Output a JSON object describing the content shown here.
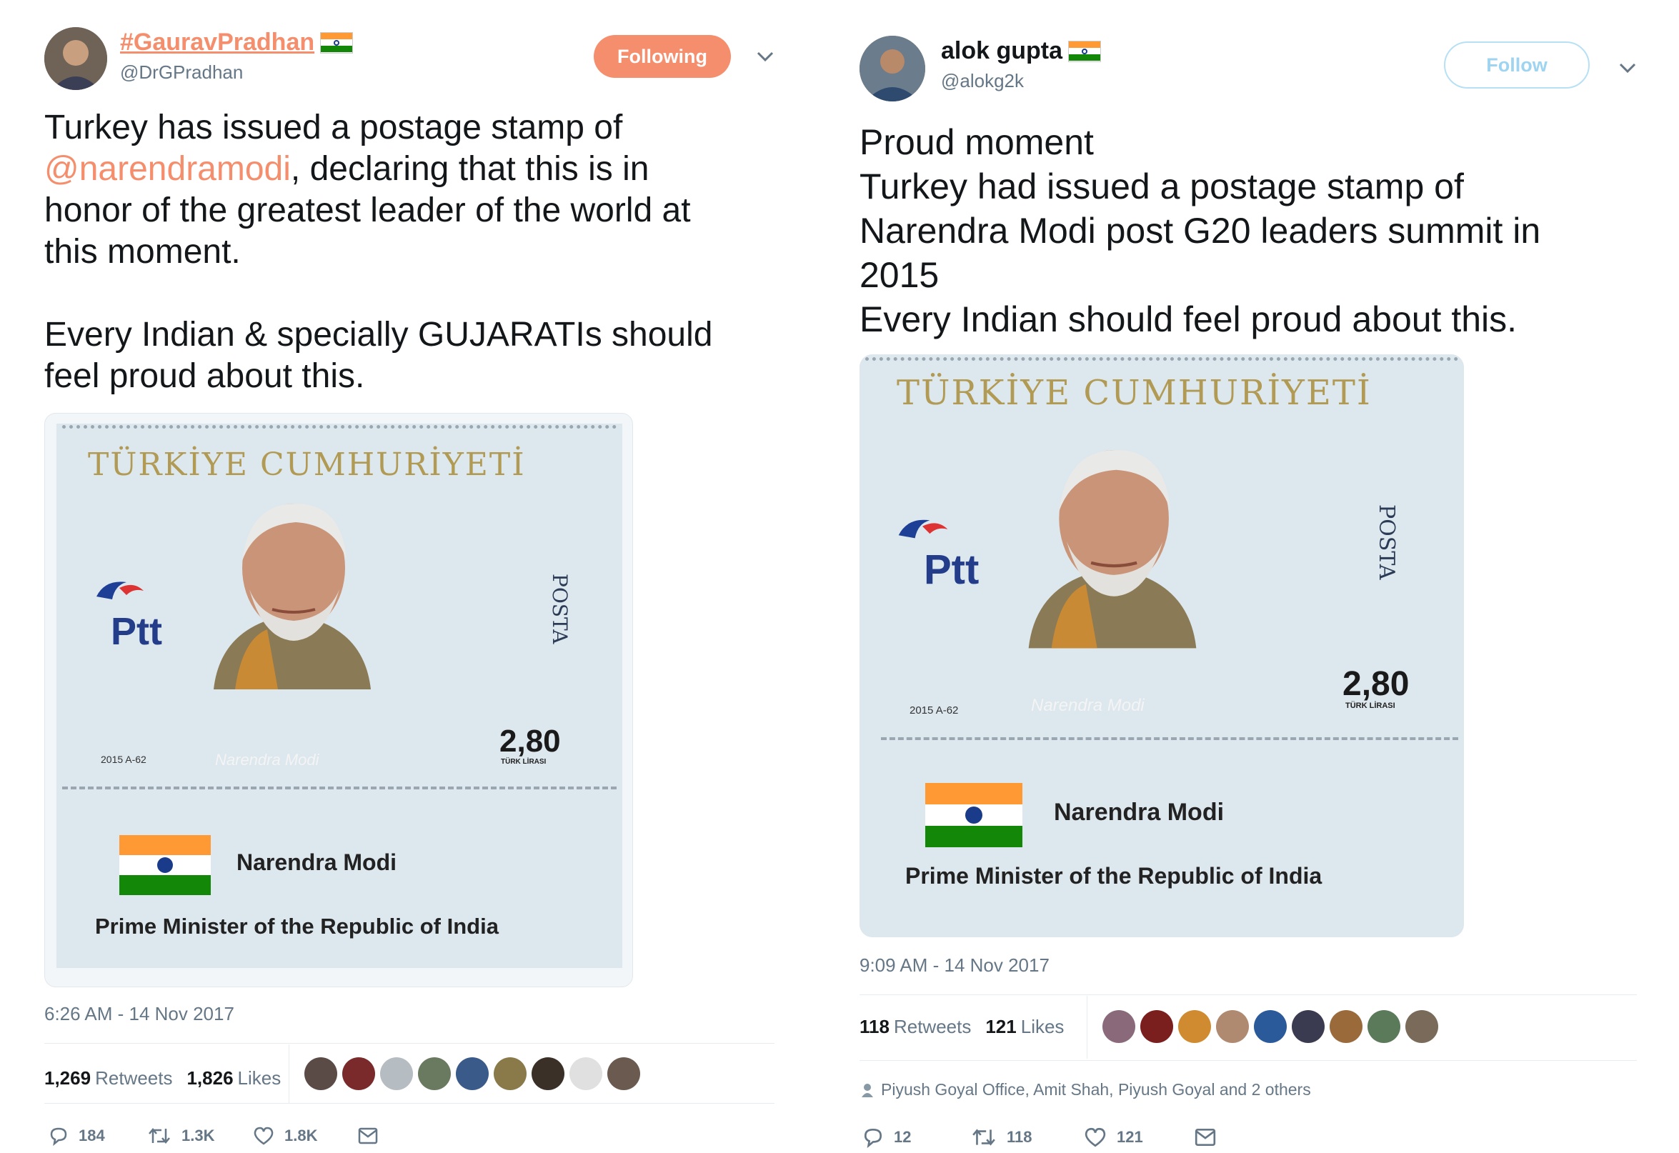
{
  "left": {
    "display_name": "#GauravPradhan",
    "handle": "@DrGPradhan",
    "follow_label": "Following",
    "body_pre": "Turkey has issued a postage stamp of\n",
    "mention": "@narendramodi",
    "body_post": ", declaring that this is in\nhonor of the greatest leader of the world at\nthis moment.\n\nEvery Indian & specially GUJARATIs should\nfeel proud about this.",
    "timestamp": "6:26 AM - 14 Nov 2017",
    "retweets_count": "1,269",
    "retweets_label": "Retweets",
    "likes_count": "1,826",
    "likes_label": "Likes",
    "reply_count": "184",
    "retweet_count": "1.3K",
    "like_count": "1.8K"
  },
  "right": {
    "display_name": "alok gupta",
    "handle": "@alokg2k",
    "follow_label": "Follow",
    "body": "Proud moment\nTurkey had issued a postage stamp of\nNarendra Modi post G20 leaders summit in\n2015\nEvery Indian should feel proud about this.",
    "timestamp": "9:09 AM - 14 Nov 2017",
    "retweets_count": "118",
    "retweets_label": "Retweets",
    "likes_count": "121",
    "likes_label": "Likes",
    "social_context": "Piyush Goyal Office, Amit Shah, Piyush Goyal and 2 others",
    "reply_count": "12",
    "retweet_count": "118",
    "like_count": "121"
  },
  "stamp": {
    "country": "TÜRKİYE CUMHURİYETİ",
    "brand": "Ptt",
    "posta": "POSTA",
    "price": "2,80",
    "price_unit": "TÜRK LİRASI",
    "year_code": "2015 A-62",
    "signature": "Narendra Modi",
    "name": "Narendra Modi",
    "title": "Prime Minister of the Republic of India"
  },
  "colors": {
    "accent": "#f58e6c",
    "follow_outline": "#b8e0f5",
    "muted": "#657786",
    "saffron": "#ff9933",
    "india_green": "#138808"
  },
  "icons": [
    "reply-icon",
    "retweet-icon",
    "heart-icon",
    "mail-icon",
    "chevron-down-icon",
    "person-icon"
  ]
}
